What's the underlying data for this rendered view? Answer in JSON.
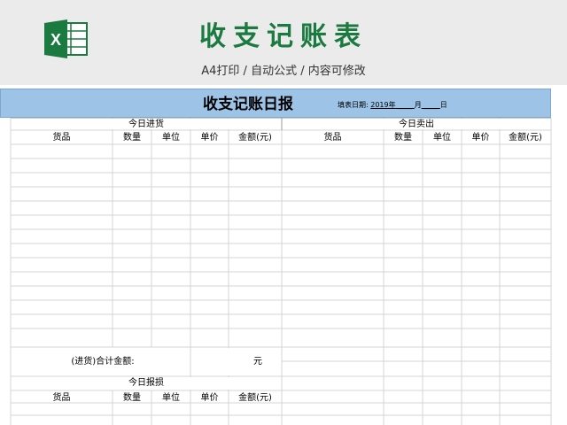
{
  "banner": {
    "title": "收支记账表",
    "subtitle": "A4打印 / 自动公式 / 内容可修改",
    "icon": "excel-icon",
    "colors": {
      "brand_green": "#1b7a40",
      "header_blue": "#9dc3e6"
    }
  },
  "sheet": {
    "title": "收支记账日报",
    "fill_date": {
      "label": "填表日期:",
      "year": "2019年",
      "month": "月",
      "day": "日"
    },
    "purchase": {
      "section_title": "今日进货",
      "columns": [
        "货品",
        "数量",
        "单位",
        "单价",
        "金额(元)"
      ],
      "total_label": "(进货)合计金额:",
      "total_unit": "元"
    },
    "sales": {
      "section_title": "今日卖出",
      "columns": [
        "货品",
        "数量",
        "单位",
        "单价",
        "金额(元)"
      ]
    },
    "loss": {
      "section_title": "今日报损",
      "columns": [
        "货品",
        "数量",
        "单位",
        "单价",
        "金额(元)"
      ]
    }
  }
}
